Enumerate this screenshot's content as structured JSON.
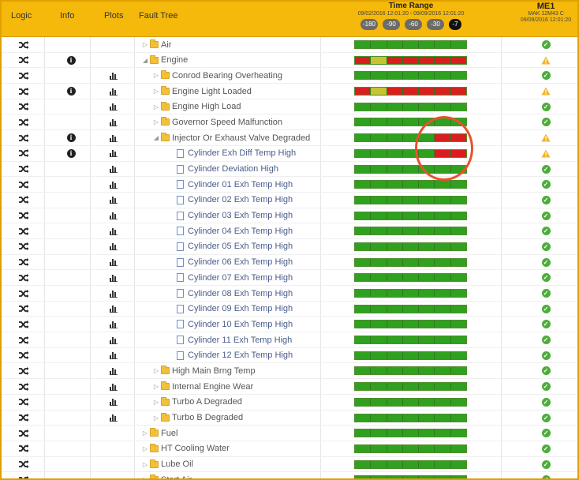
{
  "header": {
    "logic": "Logic",
    "info": "Info",
    "plots": "Plots",
    "fault_tree": "Fault Tree",
    "time_range": {
      "title": "Time Range",
      "dates": "09/02/2016 12:01:20 - 09/09/2016 12:01:20",
      "buttons": [
        "-180",
        "-90",
        "-60",
        "-30",
        "-7"
      ],
      "active": "-7"
    },
    "asset": {
      "title": "ME1",
      "model": "MAK 12M43 C",
      "timestamp": "09/09/2016 12:01:20"
    }
  },
  "colors": {
    "header": "#f5b90b",
    "ok_green": "#2fa11f",
    "alarm_red": "#d71f1f",
    "warn_yellow": "#c8c334",
    "highlight": "#e8522a"
  },
  "rows": [
    {
      "label": "Air",
      "level": 0,
      "node": "folder",
      "caret": "collapsed",
      "info": false,
      "plots": false,
      "bar": [
        "g",
        "g",
        "g",
        "g",
        "g",
        "g",
        "g"
      ],
      "status": "ok"
    },
    {
      "label": "Engine",
      "level": 0,
      "node": "folder",
      "caret": "expanded",
      "info": true,
      "plots": false,
      "bar": [
        "r",
        "y",
        "r",
        "r",
        "r",
        "r",
        "r"
      ],
      "status": "warn"
    },
    {
      "label": "Conrod Bearing Overheating",
      "level": 1,
      "node": "folder",
      "caret": "collapsed",
      "info": false,
      "plots": true,
      "bar": [
        "g",
        "g",
        "g",
        "g",
        "g",
        "g",
        "g"
      ],
      "status": "ok"
    },
    {
      "label": "Engine Light Loaded",
      "level": 1,
      "node": "folder",
      "caret": "collapsed",
      "info": true,
      "plots": true,
      "bar": [
        "r",
        "y",
        "r",
        "r",
        "r",
        "r",
        "r"
      ],
      "status": "warn"
    },
    {
      "label": "Engine High Load",
      "level": 1,
      "node": "folder",
      "caret": "collapsed",
      "info": false,
      "plots": true,
      "bar": [
        "g",
        "g",
        "g",
        "g",
        "g",
        "g",
        "g"
      ],
      "status": "ok"
    },
    {
      "label": "Governor Speed Malfunction",
      "level": 1,
      "node": "folder",
      "caret": "collapsed",
      "info": false,
      "plots": true,
      "bar": [
        "g",
        "g",
        "g",
        "g",
        "g",
        "g",
        "g"
      ],
      "status": "ok"
    },
    {
      "label": "Injector Or Exhaust Valve Degraded",
      "level": 1,
      "node": "folder",
      "caret": "expanded",
      "info": true,
      "plots": true,
      "bar": [
        "g",
        "g",
        "g",
        "g",
        "g",
        "r",
        "r"
      ],
      "status": "warn"
    },
    {
      "label": "Cylinder Exh Diff Temp High",
      "level": 2,
      "node": "file",
      "caret": "none",
      "info": true,
      "plots": true,
      "bar": [
        "g",
        "g",
        "g",
        "g",
        "g",
        "r",
        "r"
      ],
      "status": "warn"
    },
    {
      "label": "Cylinder Deviation High",
      "level": 2,
      "node": "file",
      "caret": "none",
      "info": false,
      "plots": true,
      "bar": [
        "g",
        "g",
        "g",
        "g",
        "g",
        "g",
        "g"
      ],
      "status": "ok"
    },
    {
      "label": "Cylinder 01 Exh Temp High",
      "level": 2,
      "node": "file",
      "caret": "none",
      "info": false,
      "plots": true,
      "bar": [
        "g",
        "g",
        "g",
        "g",
        "g",
        "g",
        "g"
      ],
      "status": "ok"
    },
    {
      "label": "Cylinder 02 Exh Temp High",
      "level": 2,
      "node": "file",
      "caret": "none",
      "info": false,
      "plots": true,
      "bar": [
        "g",
        "g",
        "g",
        "g",
        "g",
        "g",
        "g"
      ],
      "status": "ok"
    },
    {
      "label": "Cylinder 03 Exh Temp High",
      "level": 2,
      "node": "file",
      "caret": "none",
      "info": false,
      "plots": true,
      "bar": [
        "g",
        "g",
        "g",
        "g",
        "g",
        "g",
        "g"
      ],
      "status": "ok"
    },
    {
      "label": "Cylinder 04 Exh Temp High",
      "level": 2,
      "node": "file",
      "caret": "none",
      "info": false,
      "plots": true,
      "bar": [
        "g",
        "g",
        "g",
        "g",
        "g",
        "g",
        "g"
      ],
      "status": "ok"
    },
    {
      "label": "Cylinder 05 Exh Temp High",
      "level": 2,
      "node": "file",
      "caret": "none",
      "info": false,
      "plots": true,
      "bar": [
        "g",
        "g",
        "g",
        "g",
        "g",
        "g",
        "g"
      ],
      "status": "ok"
    },
    {
      "label": "Cylinder 06 Exh Temp High",
      "level": 2,
      "node": "file",
      "caret": "none",
      "info": false,
      "plots": true,
      "bar": [
        "g",
        "g",
        "g",
        "g",
        "g",
        "g",
        "g"
      ],
      "status": "ok"
    },
    {
      "label": "Cylinder 07 Exh Temp High",
      "level": 2,
      "node": "file",
      "caret": "none",
      "info": false,
      "plots": true,
      "bar": [
        "g",
        "g",
        "g",
        "g",
        "g",
        "g",
        "g"
      ],
      "status": "ok"
    },
    {
      "label": "Cylinder 08 Exh Temp High",
      "level": 2,
      "node": "file",
      "caret": "none",
      "info": false,
      "plots": true,
      "bar": [
        "g",
        "g",
        "g",
        "g",
        "g",
        "g",
        "g"
      ],
      "status": "ok"
    },
    {
      "label": "Cylinder 09 Exh Temp High",
      "level": 2,
      "node": "file",
      "caret": "none",
      "info": false,
      "plots": true,
      "bar": [
        "g",
        "g",
        "g",
        "g",
        "g",
        "g",
        "g"
      ],
      "status": "ok"
    },
    {
      "label": "Cylinder 10 Exh Temp High",
      "level": 2,
      "node": "file",
      "caret": "none",
      "info": false,
      "plots": true,
      "bar": [
        "g",
        "g",
        "g",
        "g",
        "g",
        "g",
        "g"
      ],
      "status": "ok"
    },
    {
      "label": "Cylinder 11 Exh Temp High",
      "level": 2,
      "node": "file",
      "caret": "none",
      "info": false,
      "plots": true,
      "bar": [
        "g",
        "g",
        "g",
        "g",
        "g",
        "g",
        "g"
      ],
      "status": "ok"
    },
    {
      "label": "Cylinder 12 Exh Temp High",
      "level": 2,
      "node": "file",
      "caret": "none",
      "info": false,
      "plots": true,
      "bar": [
        "g",
        "g",
        "g",
        "g",
        "g",
        "g",
        "g"
      ],
      "status": "ok"
    },
    {
      "label": "High Main Brng Temp",
      "level": 1,
      "node": "folder",
      "caret": "collapsed",
      "info": false,
      "plots": true,
      "bar": [
        "g",
        "g",
        "g",
        "g",
        "g",
        "g",
        "g"
      ],
      "status": "ok"
    },
    {
      "label": "Internal Engine Wear",
      "level": 1,
      "node": "folder",
      "caret": "collapsed",
      "info": false,
      "plots": true,
      "bar": [
        "g",
        "g",
        "g",
        "g",
        "g",
        "g",
        "g"
      ],
      "status": "ok"
    },
    {
      "label": "Turbo A Degraded",
      "level": 1,
      "node": "folder",
      "caret": "collapsed",
      "info": false,
      "plots": true,
      "bar": [
        "g",
        "g",
        "g",
        "g",
        "g",
        "g",
        "g"
      ],
      "status": "ok"
    },
    {
      "label": "Turbo B Degraded",
      "level": 1,
      "node": "folder",
      "caret": "collapsed",
      "info": false,
      "plots": true,
      "bar": [
        "g",
        "g",
        "g",
        "g",
        "g",
        "g",
        "g"
      ],
      "status": "ok"
    },
    {
      "label": "Fuel",
      "level": 0,
      "node": "folder",
      "caret": "collapsed",
      "info": false,
      "plots": false,
      "bar": [
        "g",
        "g",
        "g",
        "g",
        "g",
        "g",
        "g"
      ],
      "status": "ok"
    },
    {
      "label": "HT Cooling Water",
      "level": 0,
      "node": "folder",
      "caret": "collapsed",
      "info": false,
      "plots": false,
      "bar": [
        "g",
        "g",
        "g",
        "g",
        "g",
        "g",
        "g"
      ],
      "status": "ok"
    },
    {
      "label": "Lube Oil",
      "level": 0,
      "node": "folder",
      "caret": "collapsed",
      "info": false,
      "plots": false,
      "bar": [
        "g",
        "g",
        "g",
        "g",
        "g",
        "g",
        "g"
      ],
      "status": "ok"
    },
    {
      "label": "Start Air",
      "level": 0,
      "node": "folder",
      "caret": "collapsed",
      "info": false,
      "plots": false,
      "bar": [
        "g",
        "g",
        "g",
        "g",
        "g",
        "g",
        "g"
      ],
      "status": "ok"
    }
  ]
}
